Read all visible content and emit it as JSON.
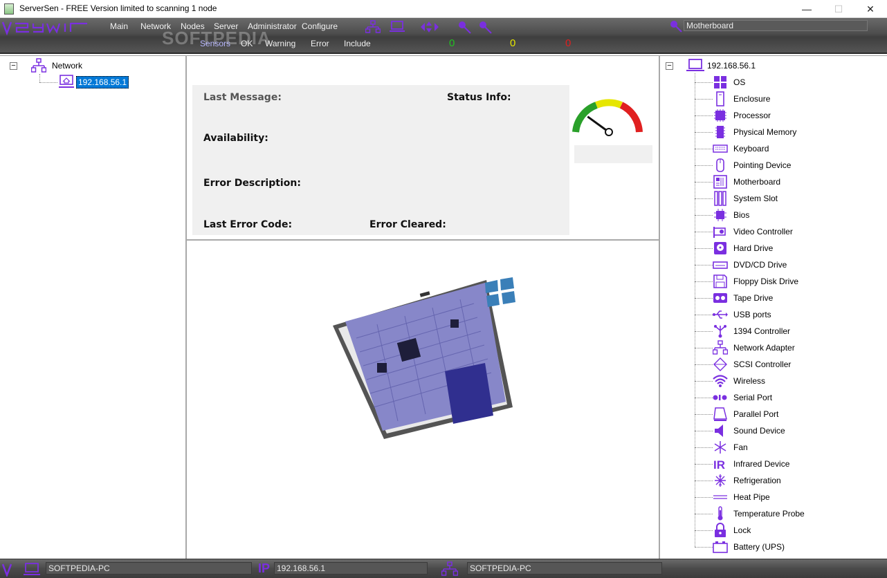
{
  "window": {
    "title": "ServerSen - FREE Version limited to scanning 1 node",
    "minimize": "—",
    "maximize": "☐",
    "close": "✕"
  },
  "watermark": "SOFTPEDIA",
  "menu": {
    "items": [
      "Main",
      "Network",
      "Nodes",
      "Server",
      "Administrator",
      "Configure"
    ]
  },
  "submenu": {
    "items": [
      "Sensors",
      "OK",
      "Warning",
      "Error",
      "Include"
    ]
  },
  "counts": {
    "ok": "0",
    "warning": "0",
    "error": "0",
    "ok_color": "#22c022",
    "warning_color": "#e6e600",
    "error_color": "#e02020"
  },
  "search": {
    "value": "Motherboard"
  },
  "left_tree": {
    "root": "Network",
    "child": "192.168.56.1"
  },
  "info": {
    "last_message": "Last Message:",
    "status_info": "Status Info:",
    "availability": "Availability:",
    "error_description": "Error Description:",
    "last_error_code": "Last Error Code:",
    "error_cleared": "Error Cleared:"
  },
  "gauge": {
    "level_fraction": 0.2,
    "colors": [
      "#2aa02a",
      "#e6e600",
      "#e02020"
    ]
  },
  "right_tree": {
    "root": "192.168.56.1",
    "items": [
      {
        "label": "OS",
        "icon": "os-icon"
      },
      {
        "label": "Enclosure",
        "icon": "enclosure-icon"
      },
      {
        "label": "Processor",
        "icon": "processor-icon"
      },
      {
        "label": "Physical Memory",
        "icon": "memory-icon"
      },
      {
        "label": "Keyboard",
        "icon": "keyboard-icon"
      },
      {
        "label": "Pointing Device",
        "icon": "mouse-icon"
      },
      {
        "label": "Motherboard",
        "icon": "motherboard-icon"
      },
      {
        "label": "System Slot",
        "icon": "system-slot-icon"
      },
      {
        "label": "Bios",
        "icon": "bios-icon"
      },
      {
        "label": "Video Controller",
        "icon": "video-controller-icon"
      },
      {
        "label": "Hard Drive",
        "icon": "hard-drive-icon"
      },
      {
        "label": "DVD/CD Drive",
        "icon": "dvd-drive-icon"
      },
      {
        "label": "Floppy Disk Drive",
        "icon": "floppy-icon"
      },
      {
        "label": "Tape Drive",
        "icon": "tape-drive-icon"
      },
      {
        "label": "USB ports",
        "icon": "usb-icon"
      },
      {
        "label": "1394 Controller",
        "icon": "firewire-icon"
      },
      {
        "label": "Network Adapter",
        "icon": "network-adapter-icon"
      },
      {
        "label": "SCSI Controller",
        "icon": "scsi-icon"
      },
      {
        "label": "Wireless",
        "icon": "wireless-icon"
      },
      {
        "label": "Serial Port",
        "icon": "serial-port-icon"
      },
      {
        "label": "Parallel Port",
        "icon": "parallel-port-icon"
      },
      {
        "label": "Sound Device",
        "icon": "sound-icon"
      },
      {
        "label": "Fan",
        "icon": "fan-icon"
      },
      {
        "label": "Infrared Device",
        "icon": "infrared-icon"
      },
      {
        "label": "Refrigeration",
        "icon": "refrigeration-icon"
      },
      {
        "label": "Heat Pipe",
        "icon": "heat-pipe-icon"
      },
      {
        "label": "Temperature Probe",
        "icon": "thermometer-icon"
      },
      {
        "label": "Lock",
        "icon": "lock-icon"
      },
      {
        "label": "Battery (UPS)",
        "icon": "battery-icon"
      }
    ]
  },
  "statusbar": {
    "computer_name": "SOFTPEDIA-PC",
    "ip_label": "IP",
    "ip": "192.168.56.1",
    "server_name": "SOFTPEDIA-PC"
  },
  "brand_color": "#6a1fc4"
}
